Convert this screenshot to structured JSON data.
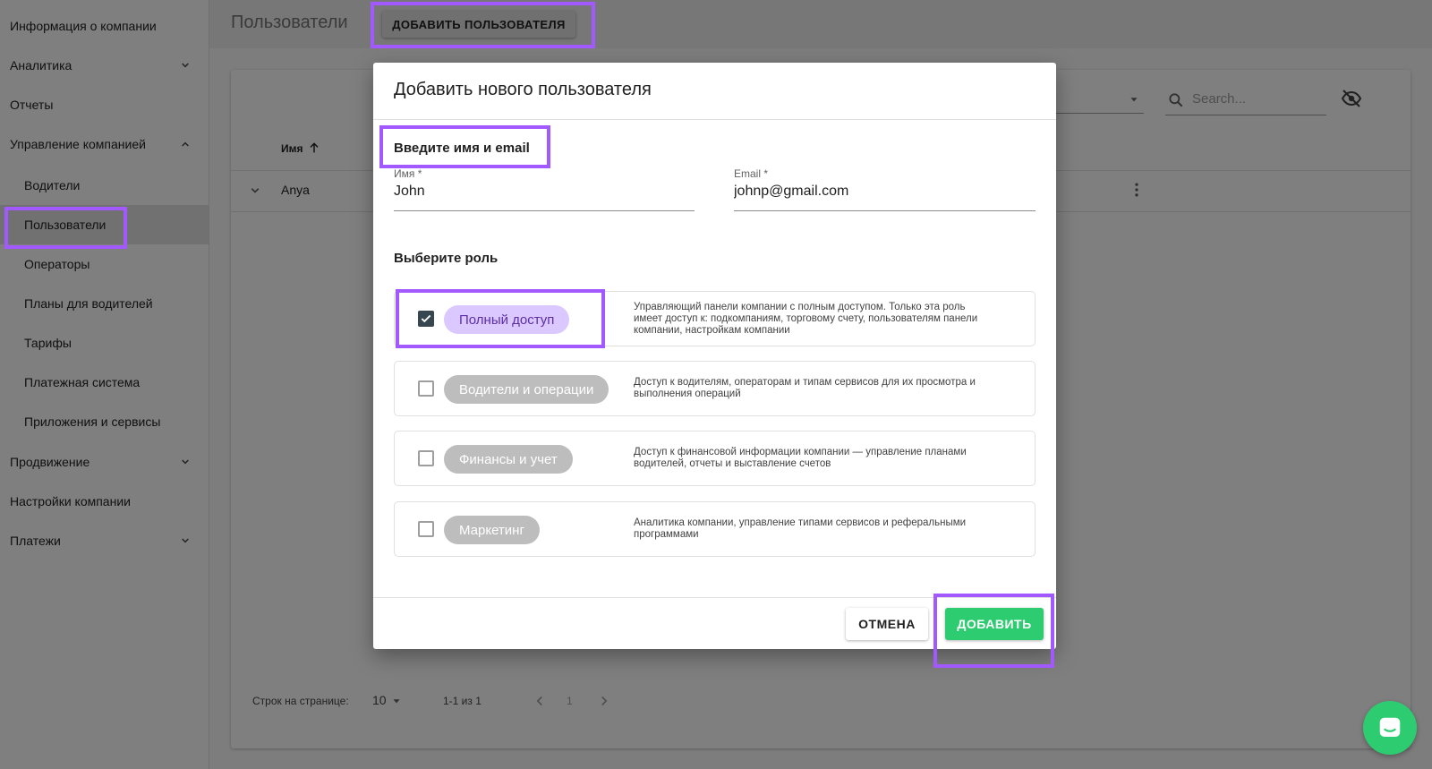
{
  "sidebar": {
    "items": [
      {
        "label": "Информация о компании"
      },
      {
        "label": "Аналитика",
        "chevron": "chevron-down"
      },
      {
        "label": "Отчеты"
      },
      {
        "label": "Управление компанией",
        "chevron": "chevron-up"
      },
      {
        "label": "Водители"
      },
      {
        "label": "Пользователи",
        "active": true
      },
      {
        "label": "Операторы"
      },
      {
        "label": "Планы для водителей"
      },
      {
        "label": "Тарифы"
      },
      {
        "label": "Платежная система"
      },
      {
        "label": "Приложения и сервисы"
      },
      {
        "label": "Продвижение",
        "chevron": "chevron-down"
      },
      {
        "label": "Настройки компании"
      },
      {
        "label": "Платежи",
        "chevron": "chevron-down"
      }
    ]
  },
  "header": {
    "title": "Пользователи",
    "add_user_label": "ДОБАВИТЬ ПОЛЬЗОВАТЕЛЯ"
  },
  "table": {
    "search_placeholder": "Search...",
    "columns": [
      {
        "label": "Имя",
        "sort": "asc"
      }
    ],
    "rows": [
      {
        "name": "Anya"
      }
    ],
    "pagination": {
      "rows_per_page_label": "Строк на странице:",
      "rows_per_page": "10",
      "range": "1-1 из 1",
      "page": "1"
    }
  },
  "dialog": {
    "title": "Добавить нового пользователя",
    "name_email_section": "Введите имя и email",
    "name_field": {
      "label": "Имя *",
      "value": "John"
    },
    "email_field": {
      "label": "Email *",
      "value": "johnp@gmail.com"
    },
    "role_section": "Выберите роль",
    "roles": [
      {
        "chip": "Полный доступ",
        "checked": true,
        "description": "Управляющий панели компании с полным доступом. Только эта роль имеет доступ к: подкомпаниям, торговому счету, пользователям панели компании, настройкам компании"
      },
      {
        "chip": "Водители и операции",
        "checked": false,
        "description": "Доступ к водителям, операторам и типам сервисов для их просмотра и выполнения операций"
      },
      {
        "chip": "Финансы и учет",
        "checked": false,
        "description": "Доступ к финансовой информации компании — управление планами водителей, отчеты и выставление счетов"
      },
      {
        "chip": "Маркетинг",
        "checked": false,
        "description": "Аналитика компании, управление типами сервисов и реферальными программами"
      }
    ],
    "cancel_label": "ОТМЕНА",
    "add_label": "ДОБАВИТЬ"
  },
  "colors": {
    "highlight": "#a259ff",
    "primary_green": "#2ecc71",
    "chip_active_bg": "#dbc8ff"
  },
  "icons": [
    "chevron-down-icon",
    "chevron-up-icon",
    "search-icon",
    "visibility-off-icon",
    "sort-arrow-up-icon",
    "expand-row-icon",
    "more-vert-icon",
    "chat-icon"
  ]
}
